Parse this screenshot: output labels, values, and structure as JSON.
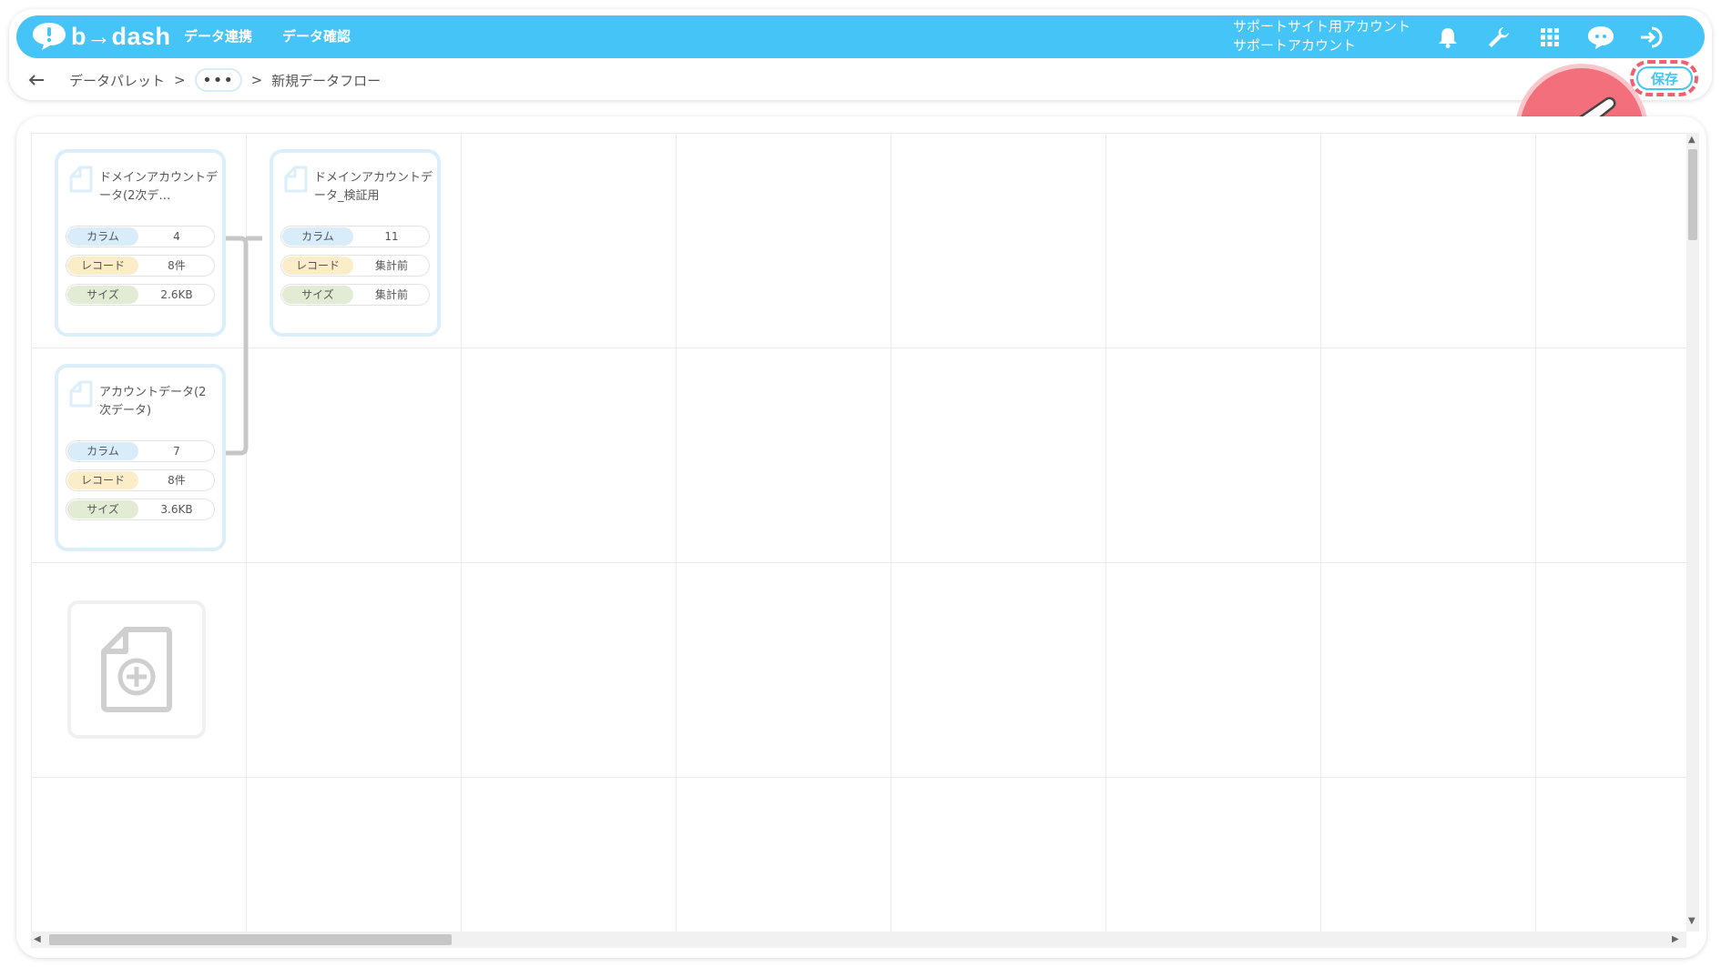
{
  "app": {
    "logo": "b→dash"
  },
  "nav": [
    {
      "label": "データ連携"
    },
    {
      "label": "データ確認"
    }
  ],
  "account": {
    "site": "サポートサイト用アカウント",
    "user": "サポートアカウント"
  },
  "icons": [
    "bell-icon",
    "wrench-icon",
    "apps-grid-icon",
    "support-chat-icon",
    "logout-icon",
    "back-arrow-icon",
    "document-icon",
    "add-document-icon",
    "pointing-hand-icon"
  ],
  "breadcrumb": {
    "root": "データパレット",
    "sep1": ">",
    "ellipsis": "•••",
    "sep2": ">",
    "current": "新規データフロー"
  },
  "toolbar": {
    "save_label": "保存"
  },
  "colors": {
    "primary": "#45c4f8",
    "highlight": "#f06070",
    "pointer_bg": "#f36f7c"
  },
  "cards": [
    {
      "title": "ドメインアカウントデータ(2次デ…",
      "rows": [
        {
          "label": "カラム",
          "value": "4"
        },
        {
          "label": "レコード",
          "value": "8件"
        },
        {
          "label": "サイズ",
          "value": "2.6KB"
        }
      ]
    },
    {
      "title": "ドメインアカウントデータ_検証用",
      "rows": [
        {
          "label": "カラム",
          "value": "11"
        },
        {
          "label": "レコード",
          "value": "集計前"
        },
        {
          "label": "サイズ",
          "value": "集計前"
        }
      ]
    },
    {
      "title": "アカウントデータ(2次データ)",
      "rows": [
        {
          "label": "カラム",
          "value": "7"
        },
        {
          "label": "レコード",
          "value": "8件"
        },
        {
          "label": "サイズ",
          "value": "3.6KB"
        }
      ]
    }
  ]
}
